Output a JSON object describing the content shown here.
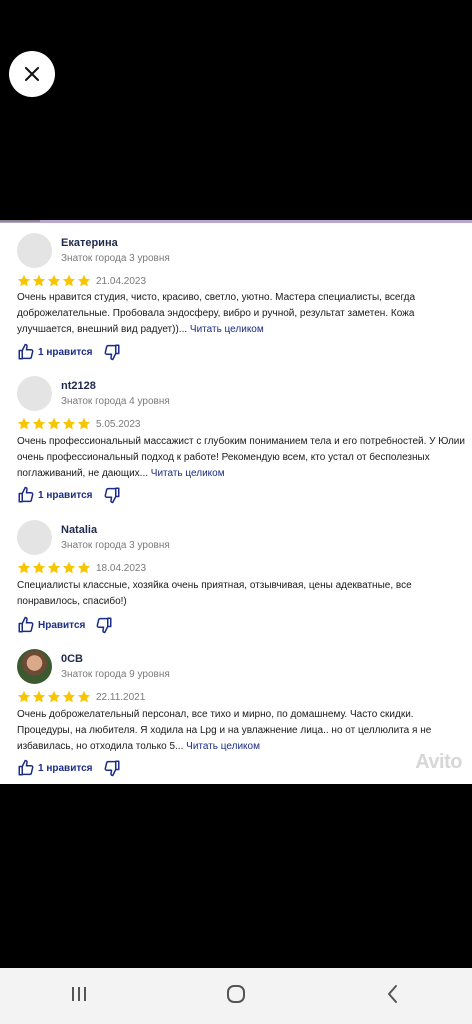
{
  "viewer": {
    "close_icon": "close-icon"
  },
  "reviews": [
    {
      "name": "Екатерина",
      "level": "Знаток города 3 уровня",
      "rating": 5,
      "date": "21.04.2023",
      "text": "Очень нравится студия, чисто, красиво, светло, уютно. Мастера специалисты, всегда доброжелательные. Пробовала эндосферу, вибро и ручной, результат заметен. Кожа улучшается, внешний вид радует))...",
      "more": "Читать целиком",
      "likes": "1 нравится"
    },
    {
      "name": "nt2128",
      "level": "Знаток города 4 уровня",
      "rating": 5,
      "date": "5.05.2023",
      "text": "Очень профессиональный массажист с глубоким пониманием тела и его потребностей. У Юлии очень профессиональный подход к работе! Рекомендую всем, кто устал от бесполезных поглаживаний, не дающих...",
      "more": "Читать целиком",
      "likes": "1 нравится"
    },
    {
      "name": "Natalia",
      "level": "Знаток города 3 уровня",
      "rating": 5,
      "date": "18.04.2023",
      "text": "Специалисты классные, хозяйка очень приятная, отзывчивая, цены адекватные, все понравилось, спасибо!)",
      "more": "",
      "likes": "Нравится"
    },
    {
      "name": "0СВ",
      "level": "Знаток города 9 уровня",
      "rating": 5,
      "date": "22.11.2021",
      "text": "Очень доброжелательный персонал, все тихо и мирно, по домашнему. Часто скидки. Процедуры, на любителя. Я ходила на Lpg и на увлажнение лица.. но от целлюлита я не избавилась, но отходила только 5...",
      "more": "Читать целиком",
      "likes": "1 нравится"
    }
  ],
  "watermark": "Avito",
  "colors": {
    "star": "#f7c600",
    "link": "#1b2d84",
    "name": "#1f2a4d"
  },
  "navbar": {
    "icons": [
      "recent-apps-icon",
      "home-icon",
      "back-icon"
    ]
  }
}
